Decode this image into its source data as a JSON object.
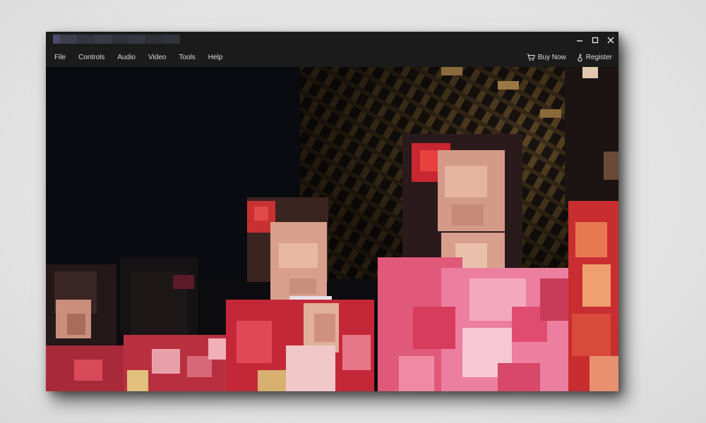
{
  "window": {
    "controls": {
      "minimize_icon": "minimize-icon",
      "maximize_icon": "maximize-icon",
      "close_icon": "close-icon"
    }
  },
  "menu": {
    "items": [
      {
        "label": "File"
      },
      {
        "label": "Controls"
      },
      {
        "label": "Audio"
      },
      {
        "label": "Video"
      },
      {
        "label": "Tools"
      },
      {
        "label": "Help"
      }
    ],
    "actions": {
      "buy_now": {
        "label": "Buy Now",
        "icon": "cart-icon"
      },
      "register": {
        "label": "Register",
        "icon": "key-icon"
      }
    }
  },
  "colors": {
    "chrome": "#1b1b1b",
    "menu_text": "#dcdcdc",
    "video_background": "#0c0c0e",
    "kimono_red": "#c8283a",
    "kimono_pink": "#e86a8e"
  }
}
